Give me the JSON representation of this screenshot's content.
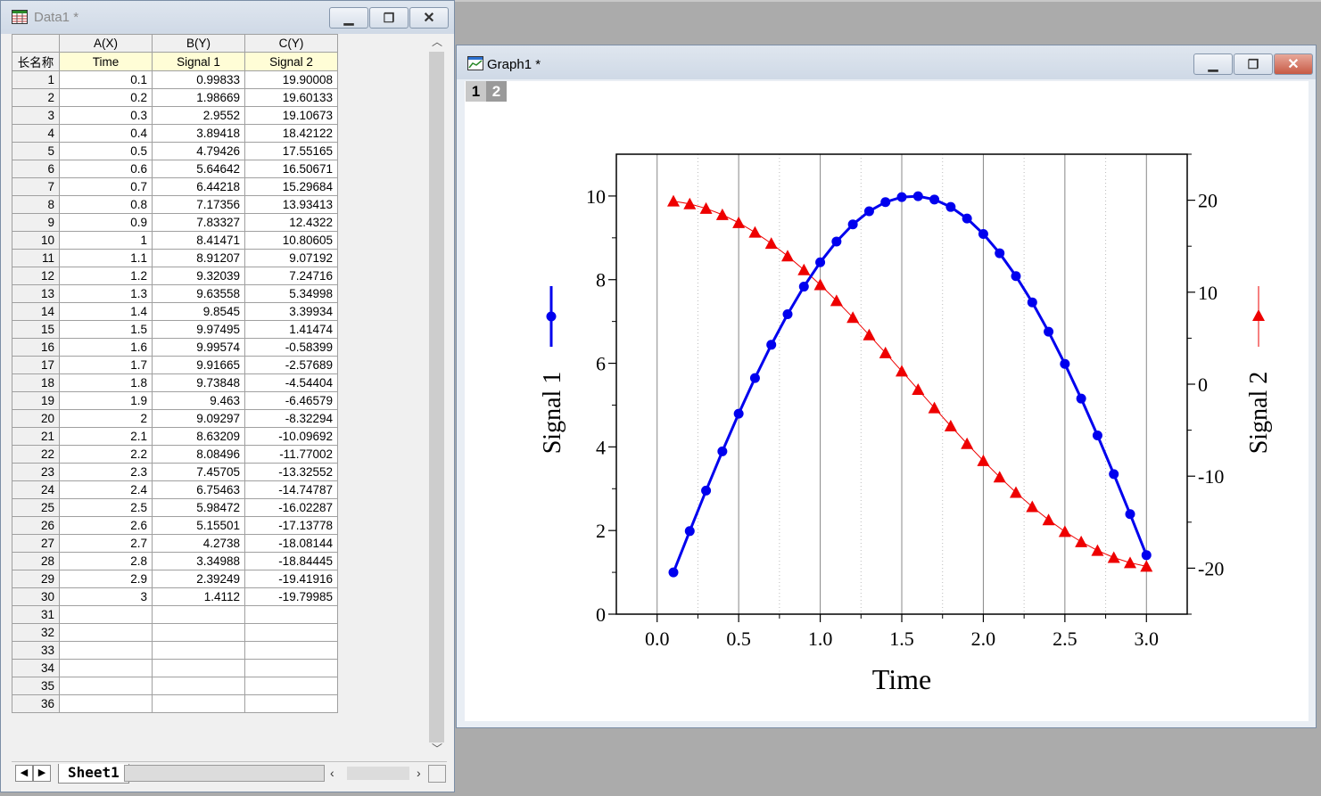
{
  "data_window": {
    "title": "Data1 *",
    "corner_label": "长名称",
    "columns": [
      {
        "header": "A(X)",
        "long_name": "Time"
      },
      {
        "header": "B(Y)",
        "long_name": "Signal 1"
      },
      {
        "header": "C(Y)",
        "long_name": "Signal 2"
      }
    ],
    "rows": [
      [
        "0.1",
        "0.99833",
        "19.90008"
      ],
      [
        "0.2",
        "1.98669",
        "19.60133"
      ],
      [
        "0.3",
        "2.9552",
        "19.10673"
      ],
      [
        "0.4",
        "3.89418",
        "18.42122"
      ],
      [
        "0.5",
        "4.79426",
        "17.55165"
      ],
      [
        "0.6",
        "5.64642",
        "16.50671"
      ],
      [
        "0.7",
        "6.44218",
        "15.29684"
      ],
      [
        "0.8",
        "7.17356",
        "13.93413"
      ],
      [
        "0.9",
        "7.83327",
        "12.4322"
      ],
      [
        "1",
        "8.41471",
        "10.80605"
      ],
      [
        "1.1",
        "8.91207",
        "9.07192"
      ],
      [
        "1.2",
        "9.32039",
        "7.24716"
      ],
      [
        "1.3",
        "9.63558",
        "5.34998"
      ],
      [
        "1.4",
        "9.8545",
        "3.39934"
      ],
      [
        "1.5",
        "9.97495",
        "1.41474"
      ],
      [
        "1.6",
        "9.99574",
        "-0.58399"
      ],
      [
        "1.7",
        "9.91665",
        "-2.57689"
      ],
      [
        "1.8",
        "9.73848",
        "-4.54404"
      ],
      [
        "1.9",
        "9.463",
        "-6.46579"
      ],
      [
        "2",
        "9.09297",
        "-8.32294"
      ],
      [
        "2.1",
        "8.63209",
        "-10.09692"
      ],
      [
        "2.2",
        "8.08496",
        "-11.77002"
      ],
      [
        "2.3",
        "7.45705",
        "-13.32552"
      ],
      [
        "2.4",
        "6.75463",
        "-14.74787"
      ],
      [
        "2.5",
        "5.98472",
        "-16.02287"
      ],
      [
        "2.6",
        "5.15501",
        "-17.13778"
      ],
      [
        "2.7",
        "4.2738",
        "-18.08144"
      ],
      [
        "2.8",
        "3.34988",
        "-18.84445"
      ],
      [
        "2.9",
        "2.39249",
        "-19.41916"
      ],
      [
        "3",
        "1.4112",
        "-19.79985"
      ],
      [
        "",
        "",
        ""
      ],
      [
        "",
        "",
        ""
      ],
      [
        "",
        "",
        ""
      ],
      [
        "",
        "",
        ""
      ],
      [
        "",
        "",
        ""
      ],
      [
        "",
        "",
        ""
      ]
    ],
    "sheet_tab": "Sheet1"
  },
  "graph_window": {
    "title": "Graph1 *",
    "layers": [
      "1",
      "2"
    ]
  },
  "colors": {
    "signal1": "#0000ee",
    "signal2": "#ee0000"
  },
  "chart_data": {
    "type": "line",
    "xlabel": "Time",
    "x": [
      0.1,
      0.2,
      0.3,
      0.4,
      0.5,
      0.6,
      0.7,
      0.8,
      0.9,
      1.0,
      1.1,
      1.2,
      1.3,
      1.4,
      1.5,
      1.6,
      1.7,
      1.8,
      1.9,
      2.0,
      2.1,
      2.2,
      2.3,
      2.4,
      2.5,
      2.6,
      2.7,
      2.8,
      2.9,
      3.0
    ],
    "xlim": [
      -0.25,
      3.25
    ],
    "xticks": [
      "0.0",
      "0.5",
      "1.0",
      "1.5",
      "2.0",
      "2.5",
      "3.0"
    ],
    "series": [
      {
        "name": "Signal 1",
        "axis": "left",
        "marker": "circle",
        "ylabel": "Signal 1",
        "values": [
          0.99833,
          1.98669,
          2.9552,
          3.89418,
          4.79426,
          5.64642,
          6.44218,
          7.17356,
          7.83327,
          8.41471,
          8.91207,
          9.32039,
          9.63558,
          9.8545,
          9.97495,
          9.99574,
          9.91665,
          9.73848,
          9.463,
          9.09297,
          8.63209,
          8.08496,
          7.45705,
          6.75463,
          5.98472,
          5.15501,
          4.2738,
          3.34988,
          2.39249,
          1.4112
        ],
        "ylim": [
          0,
          11
        ],
        "yticks": [
          "0",
          "2",
          "4",
          "6",
          "8",
          "10"
        ]
      },
      {
        "name": "Signal 2",
        "axis": "right",
        "marker": "triangle",
        "ylabel": "Signal 2",
        "values": [
          19.90008,
          19.60133,
          19.10673,
          18.42122,
          17.55165,
          16.50671,
          15.29684,
          13.93413,
          12.4322,
          10.80605,
          9.07192,
          7.24716,
          5.34998,
          3.39934,
          1.41474,
          -0.58399,
          -2.57689,
          -4.54404,
          -6.46579,
          -8.32294,
          -10.09692,
          -11.77002,
          -13.32552,
          -14.74787,
          -16.02287,
          -17.13778,
          -18.08144,
          -18.84445,
          -19.41916,
          -19.79985
        ],
        "ylim": [
          -25,
          25
        ],
        "yticks": [
          "-20",
          "-10",
          "0",
          "10",
          "20"
        ]
      }
    ],
    "grid": "vertical"
  }
}
